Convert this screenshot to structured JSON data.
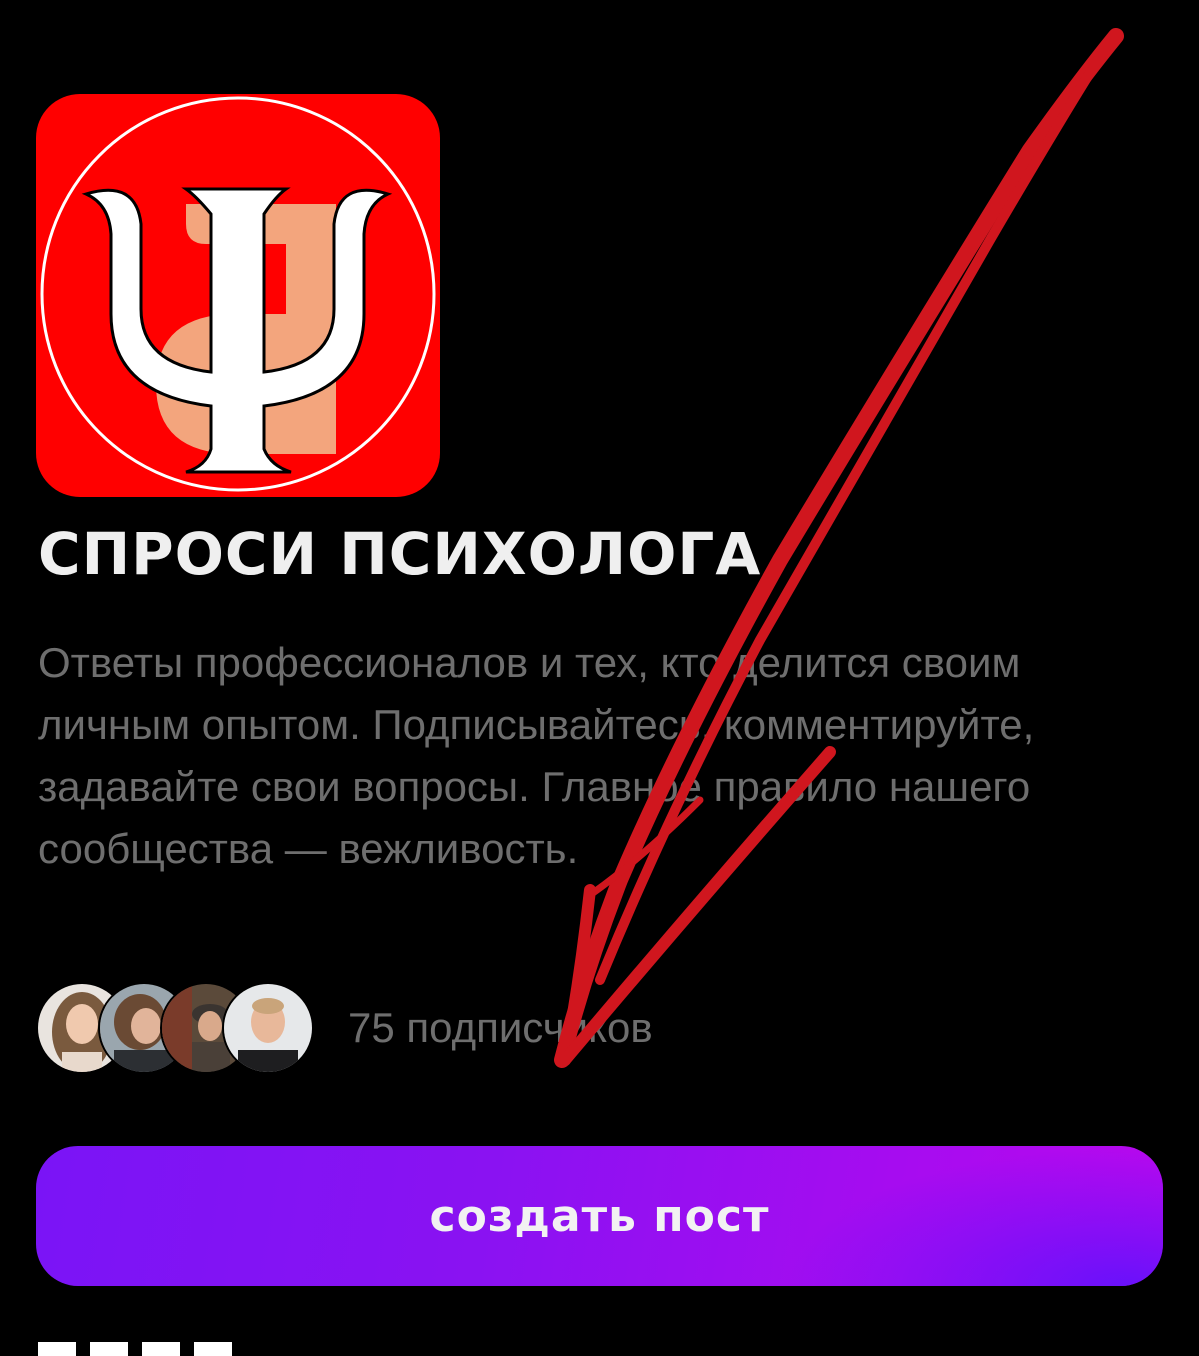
{
  "community": {
    "logo_icon": "psi-logo-icon",
    "title": "СПРОСИ ПСИХОЛОГА",
    "description": "Ответы профессионалов и тех, кто делится своим личным опытом. Подписывайтесь, комментируйте, задавайте свои вопросы. Главное правило нашего сообщества — вежливость.",
    "subscribers_text": "75 подписчиков",
    "create_post_label": "создать пост"
  },
  "colors": {
    "background": "#000000",
    "logo_red": "#ff0000",
    "button_gradient_start": "#7a14f6",
    "button_gradient_end": "#b808ee",
    "annotation_arrow": "#d0161e",
    "muted_text": "#6e6e6e"
  }
}
